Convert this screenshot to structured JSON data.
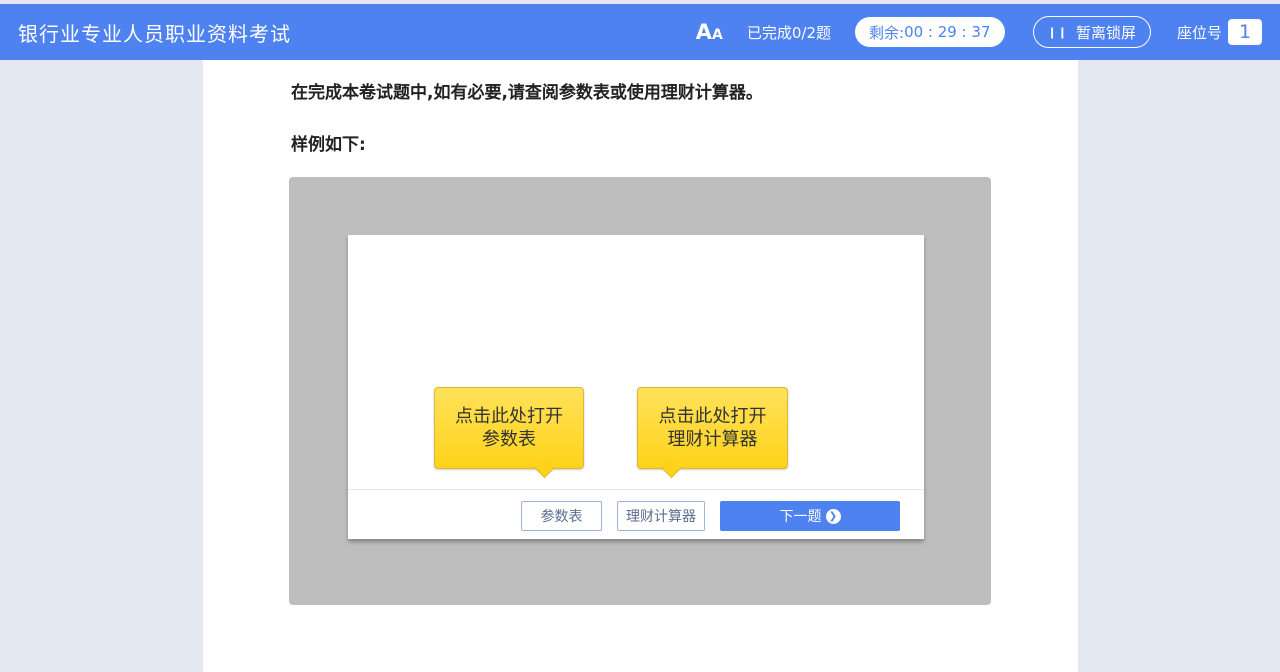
{
  "header": {
    "title": "银行业专业人员职业资料考试",
    "font_size_icon": {
      "big": "A",
      "small": "A"
    },
    "progress": "已完成0/2题",
    "timer": {
      "label": "剩余:",
      "value": "00 : 29 : 37"
    },
    "lock_label": "暂离锁屏",
    "lock_icon": "pause-icon",
    "seat": {
      "label": "座位号",
      "number": "1"
    }
  },
  "content": {
    "intro": "在完成本卷试题中,如有必要,请查阅参数表或使用理财计算器。",
    "example_label": "样例如下:",
    "example": {
      "callout_left": {
        "line1": "点击此处打开",
        "line2": "参数表"
      },
      "callout_right": {
        "line1": "点击此处打开",
        "line2": "理财计算器"
      },
      "buttons": {
        "params": "参数表",
        "calculator": "理财计算器",
        "next": "下一题"
      }
    }
  },
  "colors": {
    "primary": "#4e82f0",
    "callout": "#ffd21a",
    "example_bg": "#bebebe"
  }
}
